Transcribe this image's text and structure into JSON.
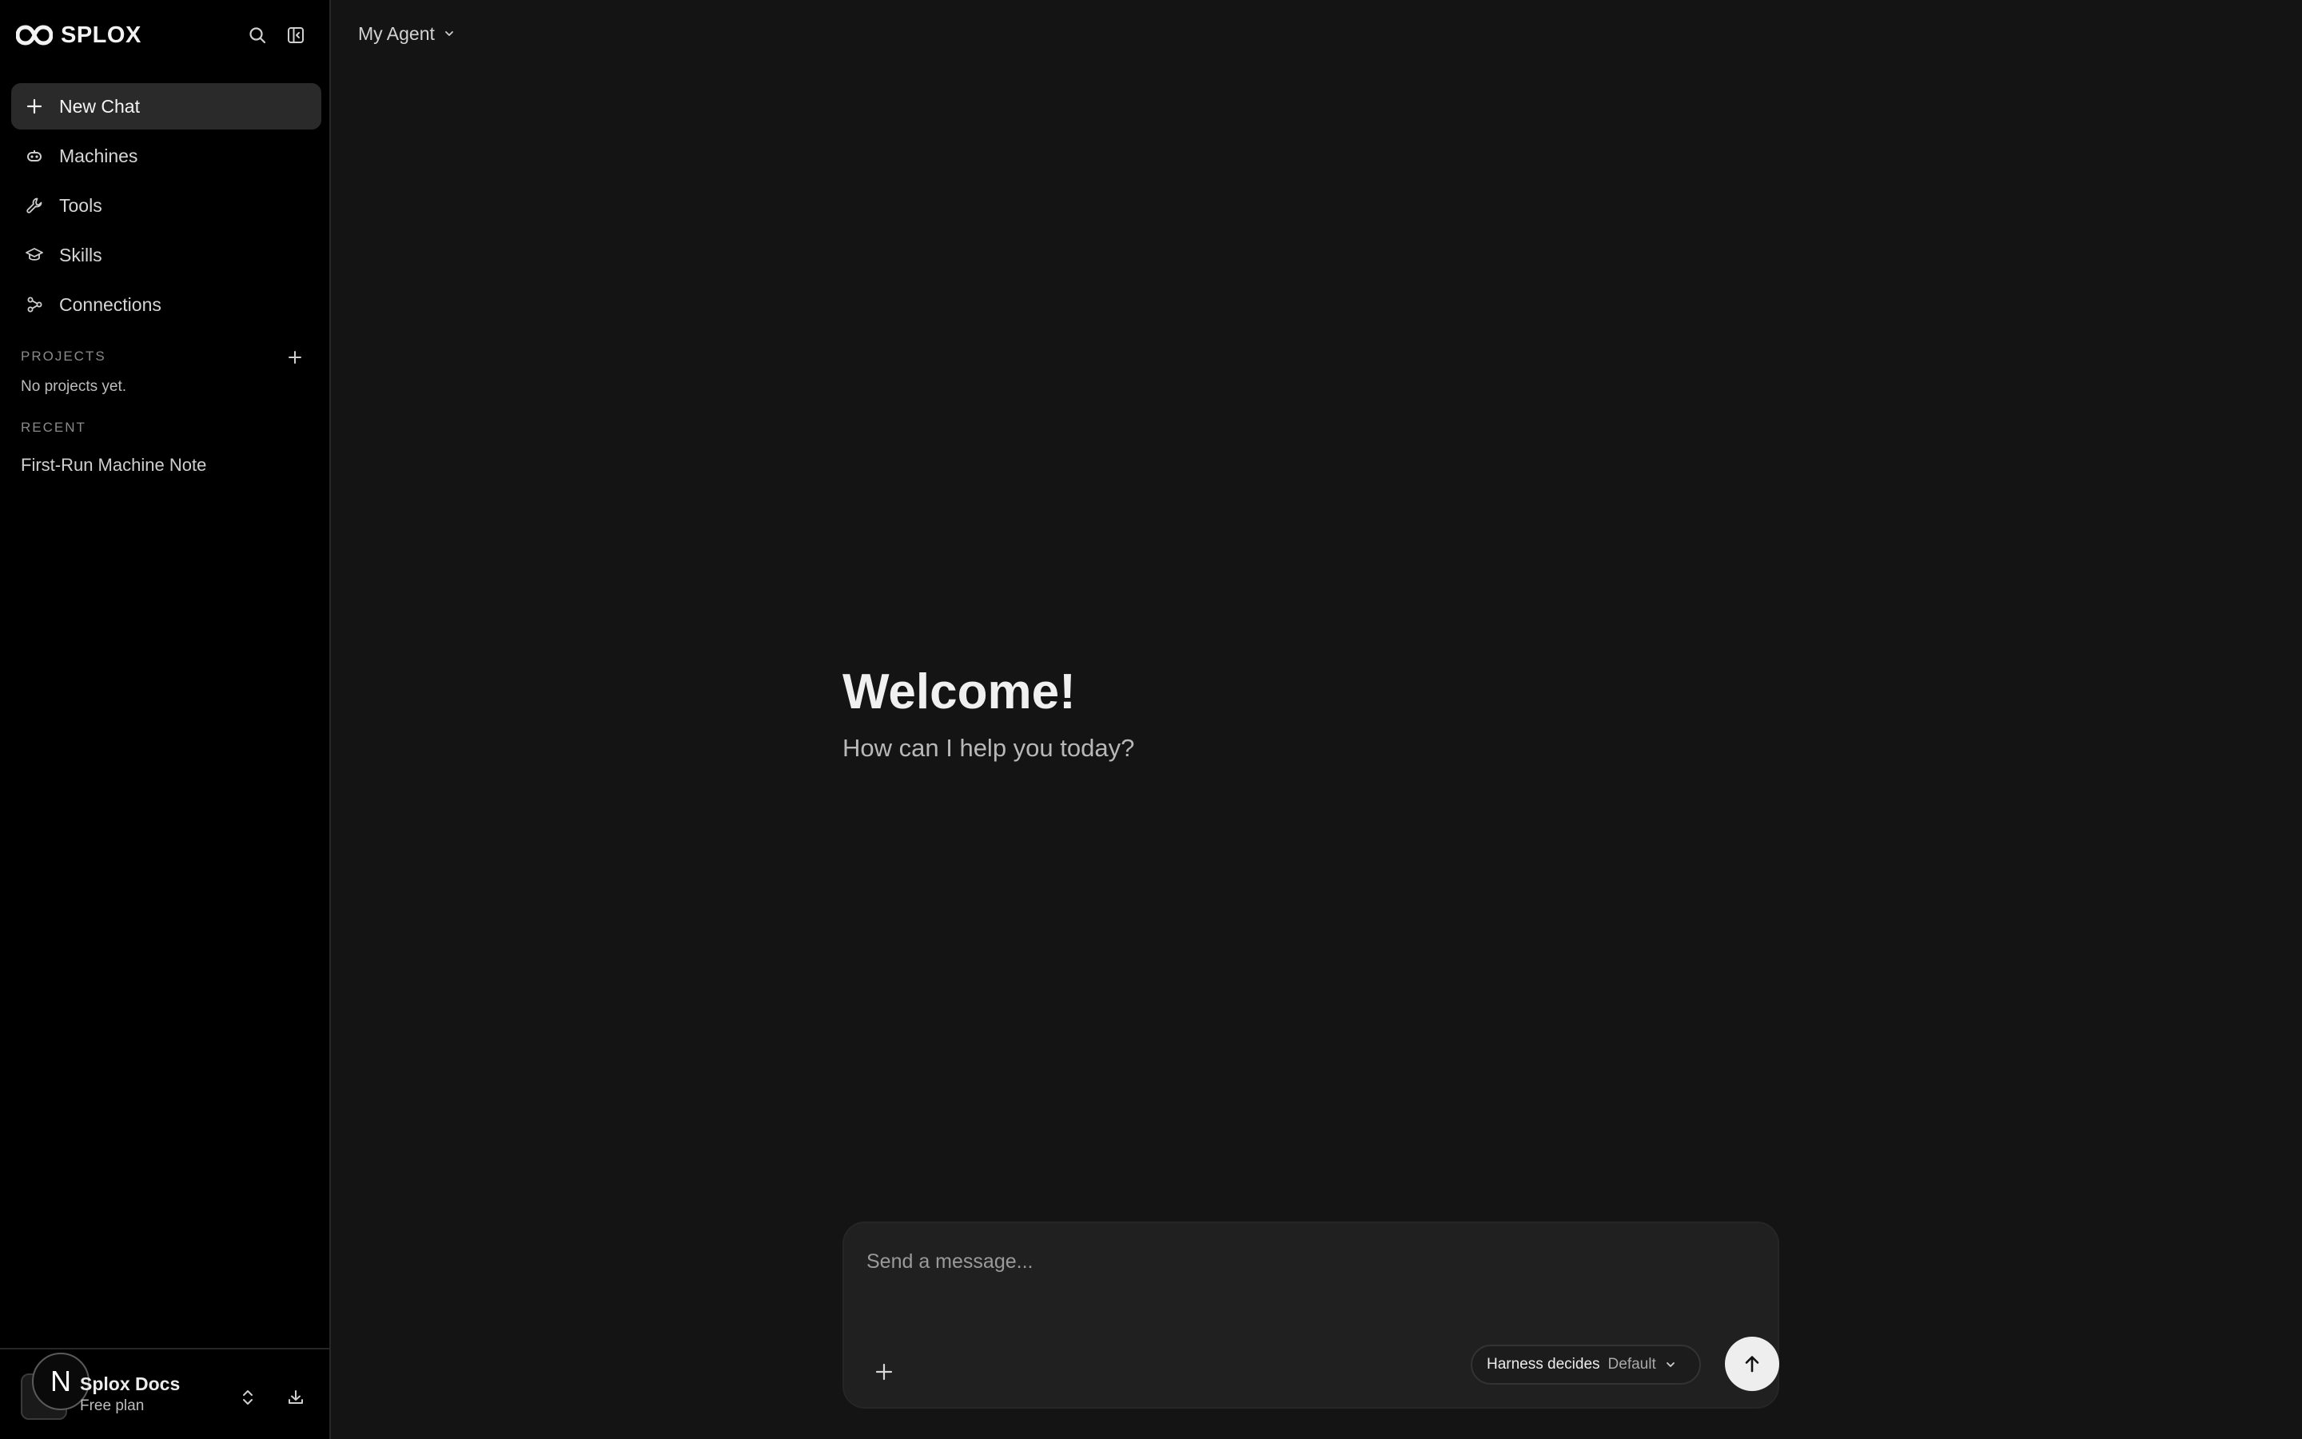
{
  "brand": {
    "name": "SPLOX",
    "logo_icon": "infinity-logo-icon"
  },
  "sidebar": {
    "nav": [
      {
        "label": "New Chat",
        "icon": "plus-icon",
        "active": true
      },
      {
        "label": "Machines",
        "icon": "robot-icon"
      },
      {
        "label": "Tools",
        "icon": "wrench-icon"
      },
      {
        "label": "Skills",
        "icon": "graduation-cap-icon"
      },
      {
        "label": "Connections",
        "icon": "connections-icon"
      }
    ],
    "projects": {
      "label": "PROJECTS",
      "empty_text": "No projects yet."
    },
    "recent": {
      "label": "RECENT",
      "items": [
        "First-Run Machine Note"
      ]
    }
  },
  "account": {
    "avatar_initial": "N",
    "name": "Splox Docs",
    "plan": "Free plan"
  },
  "main": {
    "agent_selector": "My Agent",
    "welcome_title": "Welcome!",
    "welcome_subtitle": "How can I help you today?",
    "composer": {
      "placeholder": "Send a message...",
      "mode_primary": "Harness decides",
      "mode_secondary": "Default"
    }
  }
}
